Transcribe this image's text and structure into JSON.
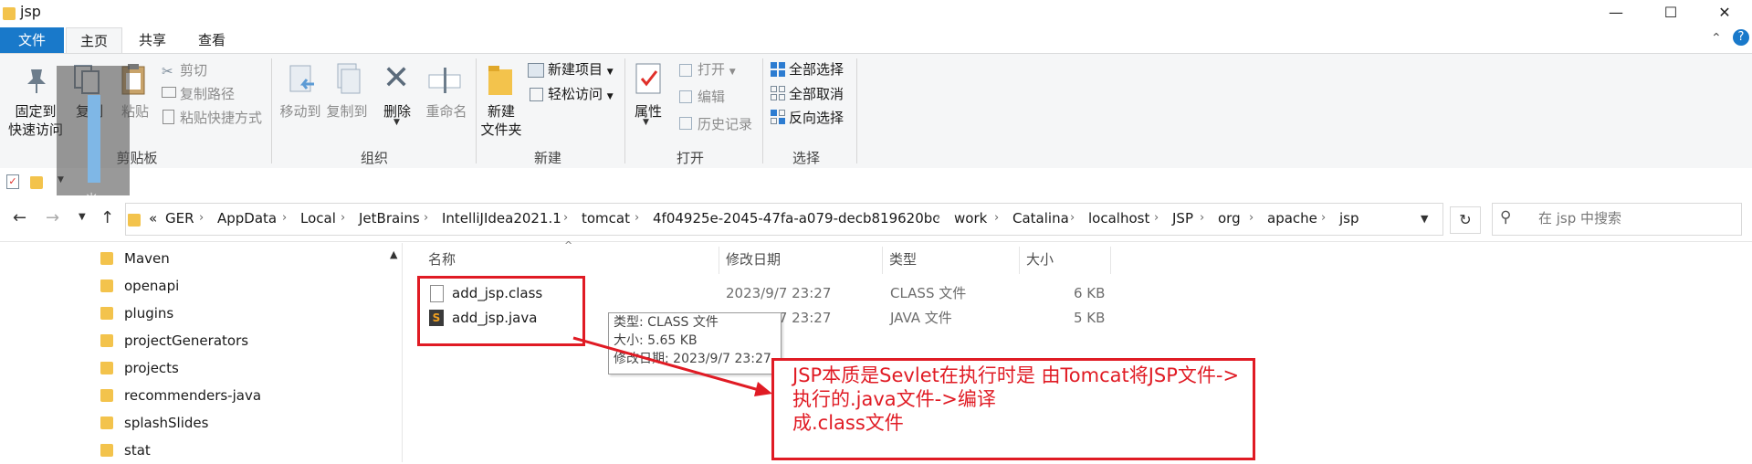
{
  "window": {
    "title": "jsp",
    "controls": {
      "minimize": "—",
      "maximize": "☐",
      "close": "✕"
    }
  },
  "menu": {
    "file": "文件",
    "tabs": [
      "主页",
      "共享",
      "查看"
    ],
    "collapse": "⌃",
    "help": "?"
  },
  "ribbon": {
    "clipboard": {
      "pin_label_1": "固定到",
      "pin_label_2": "快速访问",
      "copy": "复制",
      "paste": "粘贴",
      "cut": "剪切",
      "copy_path": "复制路径",
      "paste_shortcut": "粘贴快捷方式",
      "group": "剪贴板"
    },
    "organize": {
      "move_to": "移动到",
      "copy_to": "复制到",
      "delete": "删除",
      "rename": "重命名",
      "group": "组织"
    },
    "new": {
      "new_folder_1": "新建",
      "new_folder_2": "文件夹",
      "new_item": "新建项目",
      "easy_access": "轻松访问",
      "group": "新建"
    },
    "open": {
      "properties": "属性",
      "open": "打开",
      "edit": "编辑",
      "history": "历史记录",
      "group": "打开"
    },
    "select": {
      "select_all": "全部选择",
      "select_none": "全部取消",
      "invert": "反向选择",
      "group": "选择"
    }
  },
  "address": {
    "crumbs": [
      "«",
      "GER",
      "AppData",
      "Local",
      "JetBrains",
      "IntelliJIdea2021.1",
      "tomcat",
      "4f04925e-2045-47fa-a079-decb819620bc",
      "work",
      "Catalina",
      "localhost",
      "JSP",
      "org",
      "apache",
      "jsp"
    ],
    "search_placeholder": "在 jsp 中搜索"
  },
  "tree": [
    "Maven",
    "openapi",
    "plugins",
    "projectGenerators",
    "projects",
    "recommenders-java",
    "splashSlides",
    "stat"
  ],
  "columns": {
    "name": "名称",
    "modified": "修改日期",
    "type": "类型",
    "size": "大小"
  },
  "files": [
    {
      "name": "add_jsp.class",
      "modified": "2023/9/7 23:27",
      "type": "CLASS 文件",
      "size": "6 KB"
    },
    {
      "name": "add_jsp.java",
      "modified": "2023/9/7 23:27",
      "type": "JAVA 文件",
      "size": "5 KB"
    }
  ],
  "tooltip": {
    "type": "类型: CLASS 文件",
    "size": "大小: 5.65 KB",
    "modified": "修改日期: 2023/9/7 23:27"
  },
  "annotation": {
    "line1": "JSP本质是Sevlet在执行时是  由Tomcat将JSP文件->",
    "line2": "执行的.java文件->编译",
    "line3": "成.class文件"
  },
  "colors": {
    "accent": "#0078d7",
    "annotation": "#e01b24",
    "folder": "#f3c34c"
  }
}
